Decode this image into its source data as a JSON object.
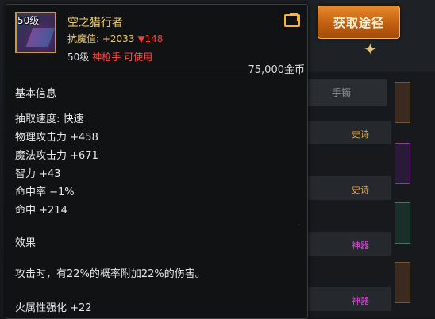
{
  "background": {
    "list_header": "手镯",
    "rows": [
      {
        "label": "史诗",
        "color": "#e8a33c"
      },
      {
        "label": "史诗",
        "color": "#e8a33c"
      },
      {
        "label": "神器",
        "color": "#d64fd6"
      },
      {
        "label": "神器",
        "color": "#d64fd6"
      }
    ]
  },
  "get_button": {
    "label": "获取途径"
  },
  "item": {
    "icon_level": "50级",
    "name": "空之猎行者",
    "resist_label": "抗魔值: ",
    "resist_value": "+2033",
    "resist_change": "▼148",
    "level": "50级",
    "class_label": "神枪手 可使用",
    "price": "75,000金币"
  },
  "basic_info": {
    "title": "基本信息",
    "stats": [
      "抽取速度: 快速",
      "物理攻击力 +458",
      "魔法攻击力 +671",
      "智力 +43",
      "命中率 −1%",
      "命中 +214"
    ]
  },
  "effect": {
    "title": "效果",
    "text": "攻击时，有22%的概率附加22%的伤害。",
    "extra": "火属性强化 +22"
  },
  "colors": {
    "gold_text": "#f6d36b",
    "red_text": "#ff3b3b",
    "button_orange": "#d36e1b"
  }
}
